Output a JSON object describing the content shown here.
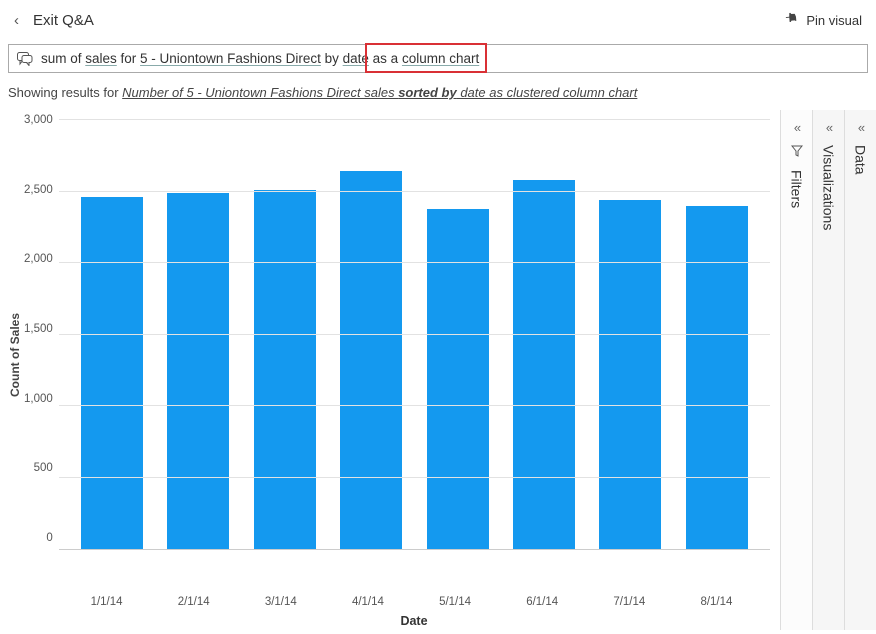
{
  "header": {
    "exit_label": "Exit Q&A",
    "pin_label": "Pin visual"
  },
  "query": {
    "t1": "sum of ",
    "t2_ul": "sales",
    "t3": " for ",
    "t4_ul": "5 - Uniontown Fashions Direct",
    "t5": " by ",
    "t6_ul": "date",
    "t7": " as a ",
    "t8_ul": "column chart"
  },
  "results": {
    "prefix": "Showing results for ",
    "part1": "Number of 5 - Uniontown Fashions Direct sales ",
    "bold": "sorted by",
    "part2": " date as clustered column chart"
  },
  "panels": {
    "filters": "Filters",
    "viz": "Visualizations",
    "data": "Data"
  },
  "chart_data": {
    "type": "bar",
    "title": "",
    "xlabel": "Date",
    "ylabel": "Count of Sales",
    "ylim": [
      0,
      3000
    ],
    "y_ticks": [
      3000,
      2500,
      2000,
      1500,
      1000,
      500,
      0
    ],
    "categories": [
      "1/1/14",
      "2/1/14",
      "3/1/14",
      "4/1/14",
      "5/1/14",
      "6/1/14",
      "7/1/14",
      "8/1/14"
    ],
    "values": [
      2460,
      2490,
      2510,
      2640,
      2380,
      2580,
      2440,
      2400
    ]
  }
}
